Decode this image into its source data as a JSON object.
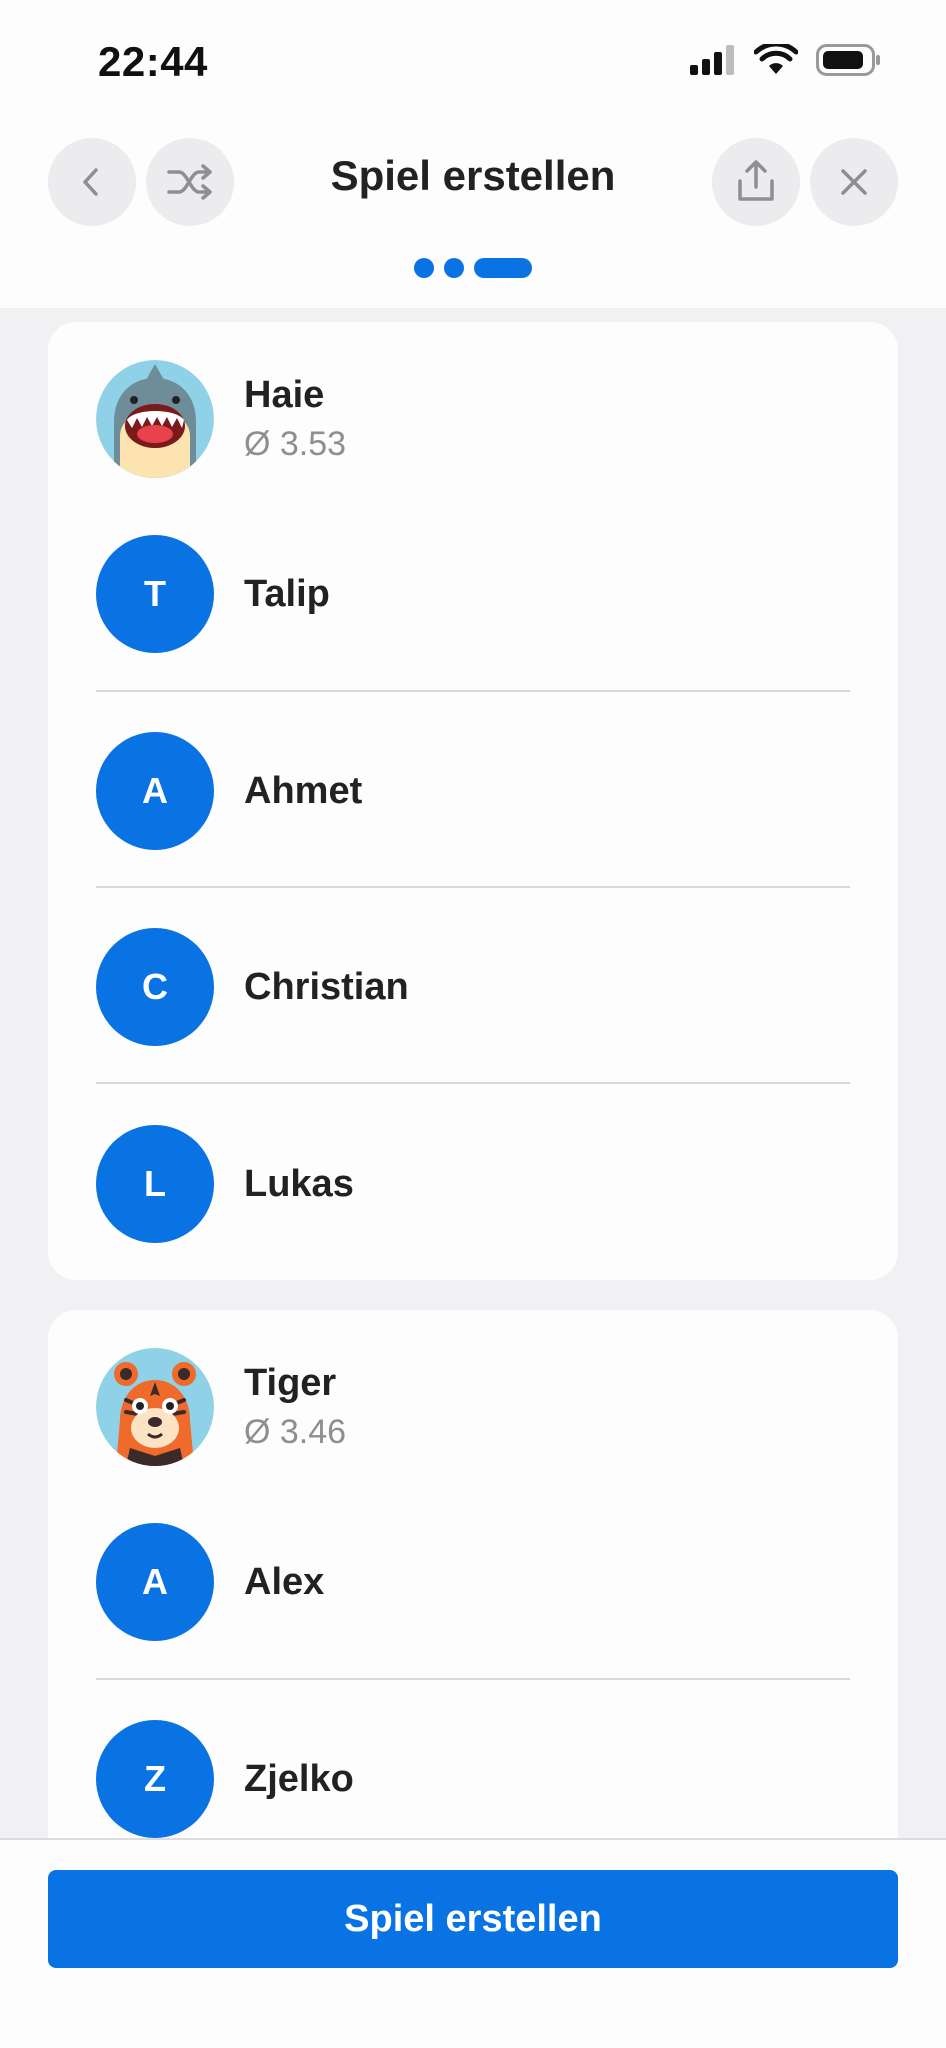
{
  "status_bar": {
    "time": "22:44"
  },
  "header": {
    "title": "Spiel erstellen",
    "steps": 3,
    "current_step": 3
  },
  "icons": {
    "back": "chevron-left-icon",
    "shuffle": "shuffle-icon",
    "share": "share-icon",
    "close": "close-icon"
  },
  "teams": [
    {
      "name": "Haie",
      "avg": "Ø 3.53",
      "mascot": "shark-avatar",
      "players": [
        {
          "initial": "T",
          "name": "Talip"
        },
        {
          "initial": "A",
          "name": "Ahmet"
        },
        {
          "initial": "C",
          "name": "Christian"
        },
        {
          "initial": "L",
          "name": "Lukas"
        }
      ]
    },
    {
      "name": "Tiger",
      "avg": "Ø 3.46",
      "mascot": "tiger-avatar",
      "players": [
        {
          "initial": "A",
          "name": "Alex"
        },
        {
          "initial": "Z",
          "name": "Zjelko"
        }
      ]
    }
  ],
  "footer": {
    "button_label": "Spiel erstellen"
  },
  "colors": {
    "accent": "#0a73e4",
    "background": "#f1f1f3",
    "card": "#fdfdfd"
  }
}
